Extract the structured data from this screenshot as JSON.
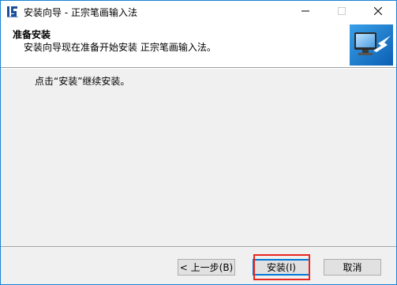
{
  "window": {
    "title": "安装向导 - 正宗笔画输入法",
    "app_icon": "installer-icon",
    "controls": {
      "minimize": "minimize-icon",
      "maximize": "maximize-icon",
      "close": "close-icon"
    }
  },
  "header": {
    "title": "准备安装",
    "subtitle": "安装向导现在准备开始安装 正宗笔画输入法。",
    "image": "computer-install-arrow-icon"
  },
  "body": {
    "message": "点击“安装”继续安装。"
  },
  "buttons": {
    "back": "< 上一步(B)",
    "install": "安装(I)",
    "cancel": "取消"
  },
  "colors": {
    "window_border": "#1883d7",
    "highlight": "#e8261f",
    "focus": "#0078d7"
  }
}
